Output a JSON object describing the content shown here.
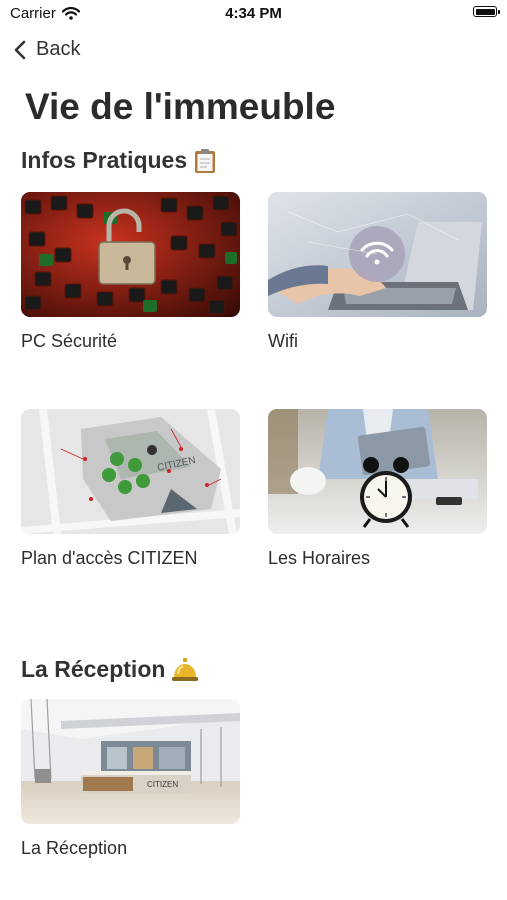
{
  "status_bar": {
    "carrier": "Carrier",
    "time": "4:34 PM"
  },
  "nav": {
    "back_label": "Back"
  },
  "page_title": "Vie de l'immeuble",
  "sections": [
    {
      "title": "Infos Pratiques",
      "icon": "clipboard-icon",
      "cards": [
        {
          "label": "PC Sécurité",
          "image": "padlock-keyboard-image"
        },
        {
          "label": "Wifi",
          "image": "laptop-wifi-image"
        },
        {
          "label": "Plan d'accès CITIZEN",
          "image": "access-map-image",
          "map_label": "CITIZEN"
        },
        {
          "label": "Les Horaires",
          "image": "alarm-clock-image"
        }
      ]
    },
    {
      "title": "La Réception",
      "icon": "service-bell-icon",
      "cards": [
        {
          "label": "La Réception",
          "image": "reception-lobby-image",
          "desk_sign": "CITIZEN"
        }
      ]
    }
  ]
}
